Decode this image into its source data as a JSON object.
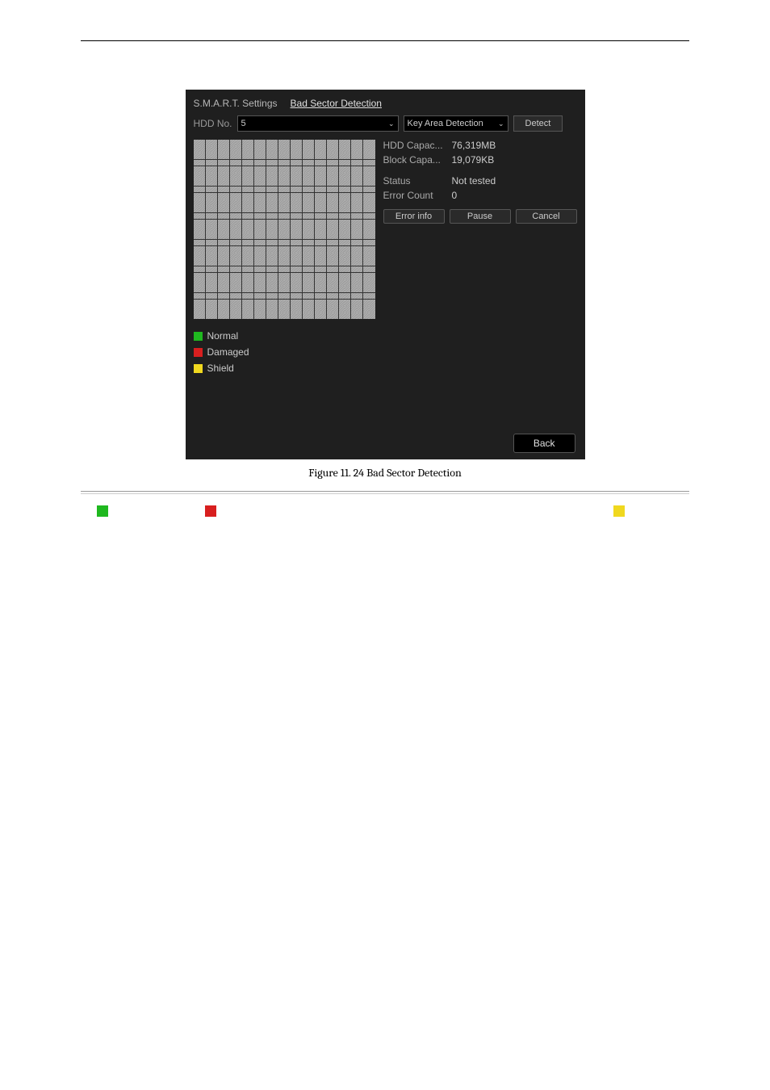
{
  "tabs": {
    "smart": "S.M.A.R.T. Settings",
    "bad_sector": "Bad Sector Detection"
  },
  "controls": {
    "hdd_no_label": "HDD No.",
    "hdd_no_value": "5",
    "area_mode": "Key Area Detection",
    "detect_label": "Detect"
  },
  "info": {
    "hdd_capac_label": "HDD Capac...",
    "hdd_capac_value": "76,319MB",
    "block_capa_label": "Block Capa...",
    "block_capa_value": "19,079KB",
    "status_label": "Status",
    "status_value": "Not tested",
    "error_count_label": "Error Count",
    "error_count_value": "0"
  },
  "buttons": {
    "error_info": "Error info",
    "pause": "Pause",
    "cancel": "Cancel",
    "back": "Back"
  },
  "legend": {
    "normal": "Normal",
    "damaged": "Damaged",
    "shield": "Shield"
  },
  "caption": "Figure 11. 24 Bad Sector Detection"
}
